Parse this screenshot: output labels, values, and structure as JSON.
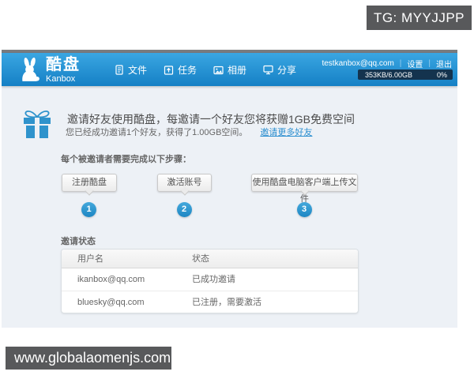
{
  "overlay": {
    "tg_label": "TG: MYYJJPP",
    "watermark": "www.globalaomenjs.com"
  },
  "header": {
    "logo_cn": "酷盘",
    "logo_en": "Kanbox",
    "nav": [
      {
        "label": "文件",
        "icon": "file-icon"
      },
      {
        "label": "任务",
        "icon": "tasks-icon"
      },
      {
        "label": "相册",
        "icon": "album-icon"
      },
      {
        "label": "分享",
        "icon": "share-icon"
      }
    ],
    "account": {
      "email": "testkanbox@qq.com",
      "settings_label": "设置",
      "logout_label": "退出"
    },
    "storage": {
      "usage": "353KB/6.00GB",
      "percent": "0%"
    }
  },
  "invite": {
    "title": "邀请好友使用酷盘，每邀请一个好友您将获赠1GB免费空间",
    "subtitle": "您已经成功邀请1个好友，获得了1.00GB空间。",
    "more_link": "邀请更多好友",
    "steps_label": "每个被邀请者需要完成以下步骤：",
    "steps": [
      {
        "num": "1",
        "label": "注册酷盘"
      },
      {
        "num": "2",
        "label": "激活账号"
      },
      {
        "num": "3",
        "label": "使用酷盘电脑客户端上传文件"
      }
    ]
  },
  "status": {
    "heading": "邀请状态",
    "columns": [
      "用户名",
      "状态"
    ],
    "rows": [
      [
        "ikanbox@qq.com",
        "已成功邀请"
      ],
      [
        "bluesky@qq.com",
        "已注册，需要激活"
      ]
    ]
  },
  "colors": {
    "header_top": "#3aa6e2",
    "header_bottom": "#1580c5",
    "accent_blue": "#2f93cc",
    "content_bg": "#edf1f6",
    "overlay_bg": "#58595b"
  }
}
